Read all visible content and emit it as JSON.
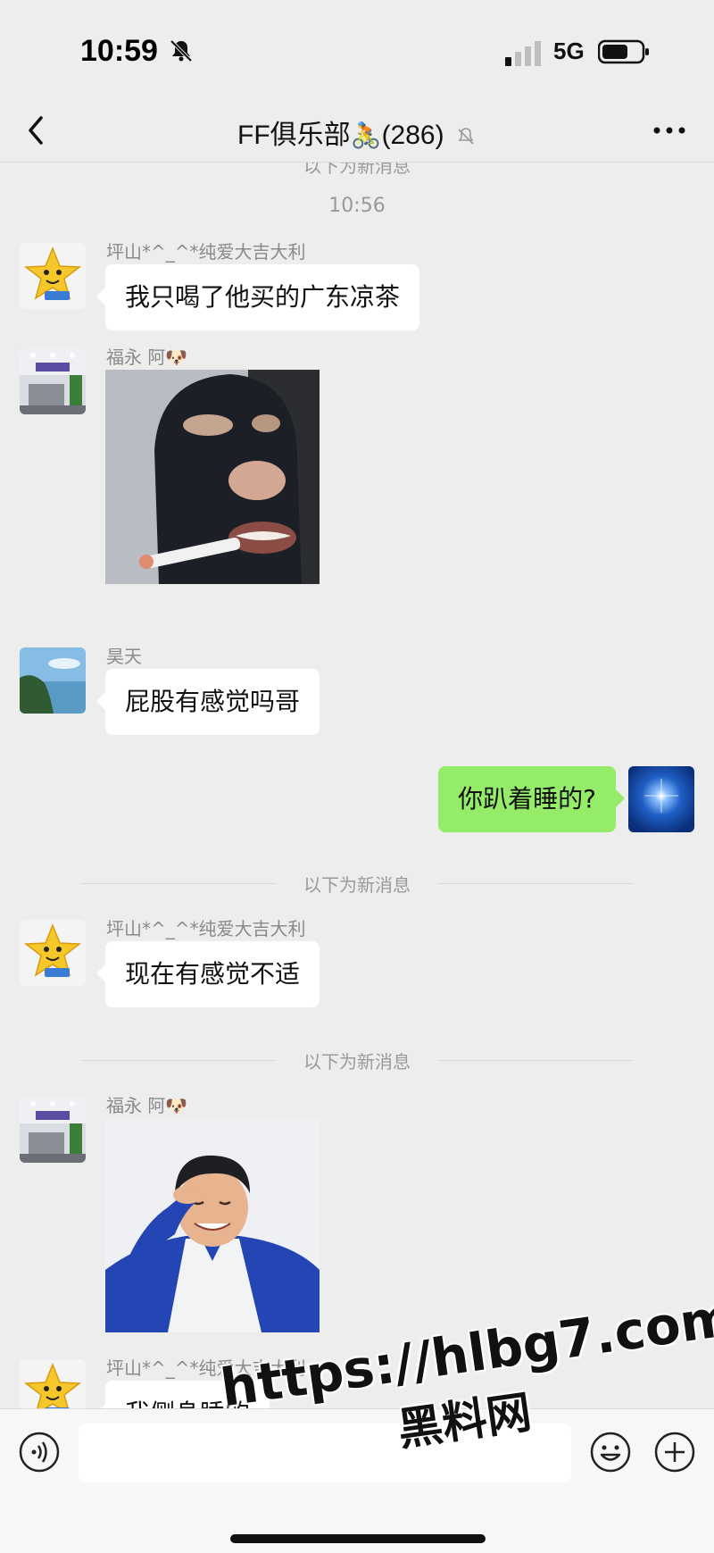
{
  "status_bar": {
    "time": "10:59",
    "network": "5G"
  },
  "header": {
    "title": "FF俱乐部",
    "title_emoji": "🚴",
    "member_count": "(286)"
  },
  "chat": {
    "cut_divider": "以下为新消息",
    "time_label": "10:56",
    "new_divider": "以下为新消息",
    "messages": [
      {
        "sender": "坪山*^_^*纯爱大吉大利",
        "text": "我只喝了他买的广东凉茶"
      },
      {
        "sender": "福永 阿🐶",
        "sticker": "masked-man-smoking-sticker"
      },
      {
        "sender": "昊天",
        "text": "屁股有感觉吗哥"
      },
      {
        "sender": "me",
        "text": "你趴着睡的?"
      },
      {
        "sender": "坪山*^_^*纯爱大吉大利",
        "text": "现在有感觉不适"
      },
      {
        "sender": "福永 阿🐶",
        "sticker": "laughing-man-sticker"
      },
      {
        "sender": "坪山*^_^*纯爱大吉大利",
        "text": "我侧身睡的"
      }
    ]
  },
  "watermark": {
    "url": "https://hlbg7.com",
    "name": "黑料网"
  },
  "colors": {
    "background": "#ededed",
    "my_bubble": "#95ec69",
    "other_bubble": "#ffffff"
  }
}
